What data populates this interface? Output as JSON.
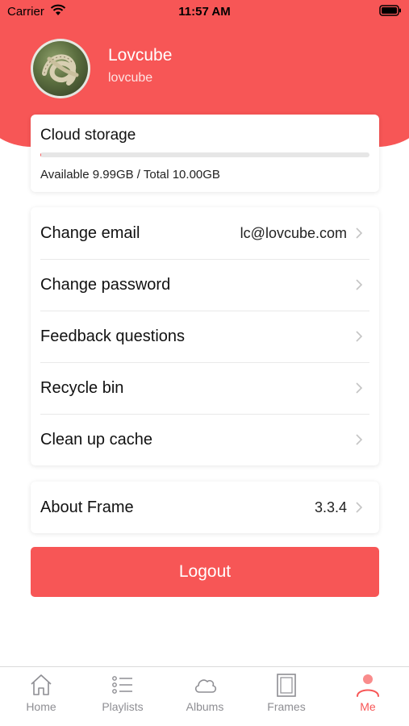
{
  "status_bar": {
    "carrier": "Carrier",
    "time": "11:57 AM"
  },
  "profile": {
    "name": "Lovcube",
    "username": "lovcube"
  },
  "storage": {
    "title": "Cloud storage",
    "used_fraction": 0.001,
    "detail": "Available 9.99GB / Total 10.00GB"
  },
  "menu": [
    {
      "label": "Change email",
      "value": "lc@lovcube.com"
    },
    {
      "label": "Change password",
      "value": ""
    },
    {
      "label": "Feedback questions",
      "value": ""
    },
    {
      "label": "Recycle bin",
      "value": ""
    },
    {
      "label": "Clean up cache",
      "value": ""
    }
  ],
  "about": {
    "label": "About Frame",
    "value": "3.3.4"
  },
  "logout_label": "Logout",
  "tabs": [
    {
      "label": "Home",
      "icon": "home-icon"
    },
    {
      "label": "Playlists",
      "icon": "list-icon"
    },
    {
      "label": "Albums",
      "icon": "cloud-icon"
    },
    {
      "label": "Frames",
      "icon": "frame-icon"
    },
    {
      "label": "Me",
      "icon": "person-icon",
      "active": true
    }
  ],
  "colors": {
    "accent": "#f75656",
    "inactive_tab": "#8e8e93"
  }
}
